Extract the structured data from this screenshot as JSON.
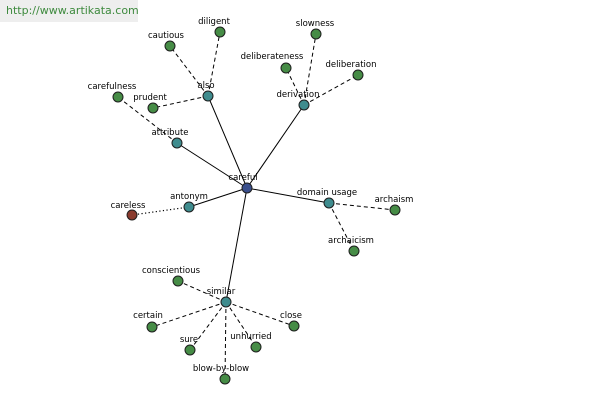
{
  "site": {
    "url": "http://www.artikata.com"
  },
  "colors": {
    "center": "#3a4f8c",
    "relation": "#3f8c8e",
    "leaf": "#468c46",
    "antonym_leaf": "#8a3b2e"
  },
  "graph": {
    "center": {
      "id": "careful",
      "label": "careful"
    },
    "relations": [
      {
        "id": "also",
        "label": "also"
      },
      {
        "id": "derivation",
        "label": "derivation"
      },
      {
        "id": "attribute",
        "label": "attribute"
      },
      {
        "id": "antonym",
        "label": "antonym"
      },
      {
        "id": "domain-usage",
        "label": "domain usage"
      },
      {
        "id": "similar",
        "label": "similar"
      }
    ],
    "leaves": [
      {
        "id": "cautious",
        "label": "cautious",
        "relation": "also"
      },
      {
        "id": "diligent",
        "label": "diligent",
        "relation": "also"
      },
      {
        "id": "prudent",
        "label": "prudent",
        "relation": "also"
      },
      {
        "id": "slowness",
        "label": "slowness",
        "relation": "derivation"
      },
      {
        "id": "deliberateness",
        "label": "deliberateness",
        "relation": "derivation"
      },
      {
        "id": "deliberation",
        "label": "deliberation",
        "relation": "derivation"
      },
      {
        "id": "carefulness",
        "label": "carefulness",
        "relation": "attribute"
      },
      {
        "id": "careless",
        "label": "careless",
        "relation": "antonym"
      },
      {
        "id": "archaism",
        "label": "archaism",
        "relation": "domain-usage"
      },
      {
        "id": "archaicism",
        "label": "archaicism",
        "relation": "domain-usage"
      },
      {
        "id": "conscientious",
        "label": "conscientious",
        "relation": "similar"
      },
      {
        "id": "certain",
        "label": "certain",
        "relation": "similar"
      },
      {
        "id": "sure",
        "label": "sure",
        "relation": "similar"
      },
      {
        "id": "unhurried",
        "label": "unhurried",
        "relation": "similar"
      },
      {
        "id": "close",
        "label": "close",
        "relation": "similar"
      },
      {
        "id": "blow-by-blow",
        "label": "blow-by-blow",
        "relation": "similar"
      }
    ]
  }
}
